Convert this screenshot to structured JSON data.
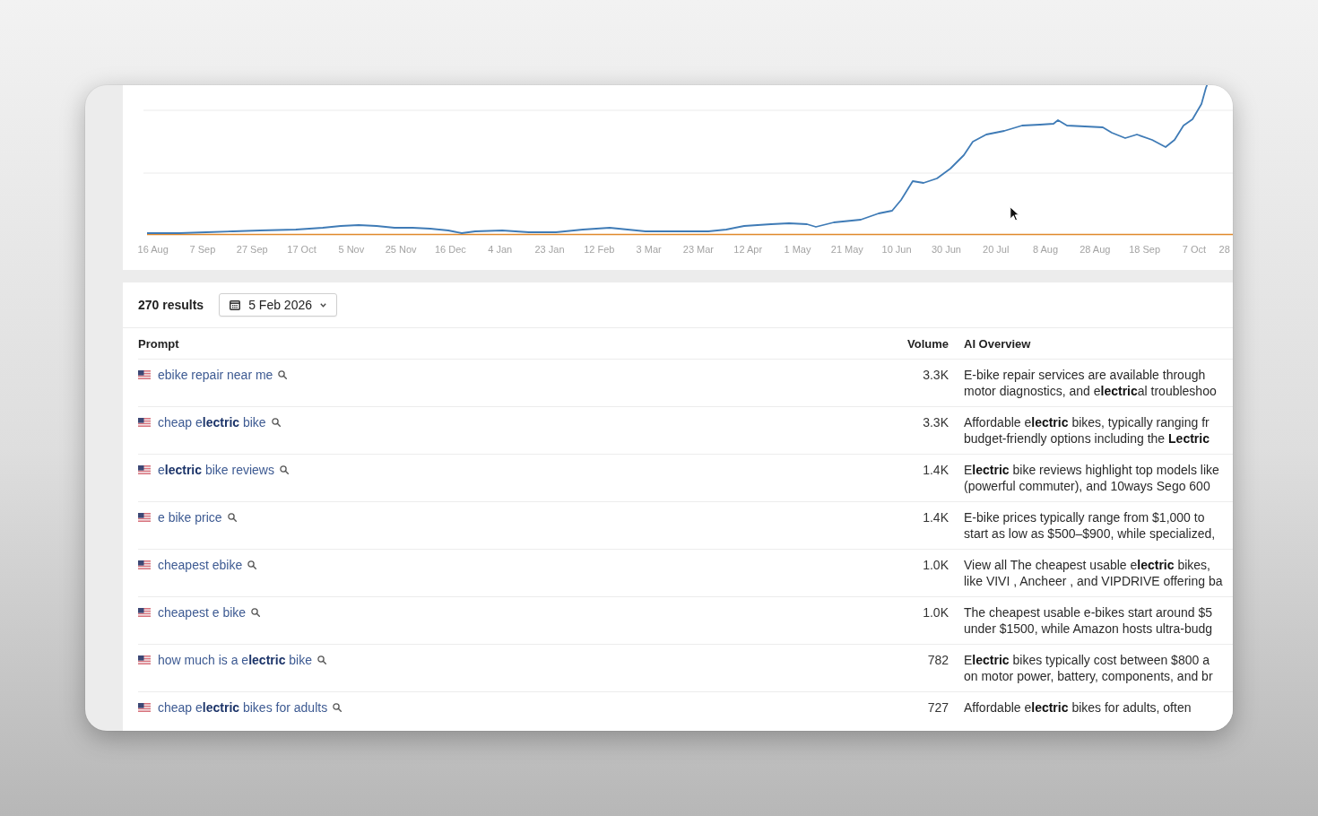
{
  "chart": {
    "x_labels": [
      "16 Aug",
      "7 Sep",
      "27 Sep",
      "17 Oct",
      "5 Nov",
      "25 Nov",
      "16 Dec",
      "4 Jan",
      "23 Jan",
      "12 Feb",
      "3 Mar",
      "23 Mar",
      "12 Apr",
      "1 May",
      "21 May",
      "10 Jun",
      "30 Jun",
      "20 Jul",
      "8 Aug",
      "28 Aug",
      "18 Sep",
      "7 Oct",
      "28"
    ]
  },
  "toolbar": {
    "results": "270 results",
    "date": "5 Feb 2026"
  },
  "table": {
    "columns": [
      "Prompt",
      "Volume",
      "AI Overview"
    ],
    "rows": [
      {
        "prompt": "ebike repair near me",
        "volume": "3.3K",
        "overview": [
          "E-bike repair services are available through",
          "motor diagnostics, and e**lectric**al troubleshoo"
        ]
      },
      {
        "prompt": "cheap e**lectric** bike",
        "volume": "3.3K",
        "overview": [
          "Affordable e**lectric** bikes, typically ranging fr",
          "budget-friendly options including the **Lectric**"
        ]
      },
      {
        "prompt": "e**lectric** bike reviews",
        "volume": "1.4K",
        "overview": [
          "E**lectric** bike reviews highlight top models like",
          "(powerful commuter), and 10ways Sego 600"
        ]
      },
      {
        "prompt": "e bike price",
        "volume": "1.4K",
        "overview": [
          "E-bike prices typically range from $1,000 to",
          "start as low as $500–$900, while specialized,"
        ]
      },
      {
        "prompt": "cheapest ebike",
        "volume": "1.0K",
        "overview": [
          "View all The cheapest usable e**lectric** bikes,",
          "like VIVI , Ancheer , and VIPDRIVE offering ba"
        ]
      },
      {
        "prompt": "cheapest e bike",
        "volume": "1.0K",
        "overview": [
          "The cheapest usable e-bikes start around $5",
          "under $1500, while Amazon hosts ultra-budg"
        ]
      },
      {
        "prompt": "how much is a e**lectric** bike",
        "volume": "782",
        "overview": [
          "E**lectric** bikes typically cost between $800 a",
          "on motor power, battery, components, and br"
        ]
      },
      {
        "prompt": "cheap e**lectric** bikes for adults",
        "volume": "727",
        "overview": [
          "Affordable e**lectric** bikes for adults, often"
        ]
      }
    ]
  }
}
